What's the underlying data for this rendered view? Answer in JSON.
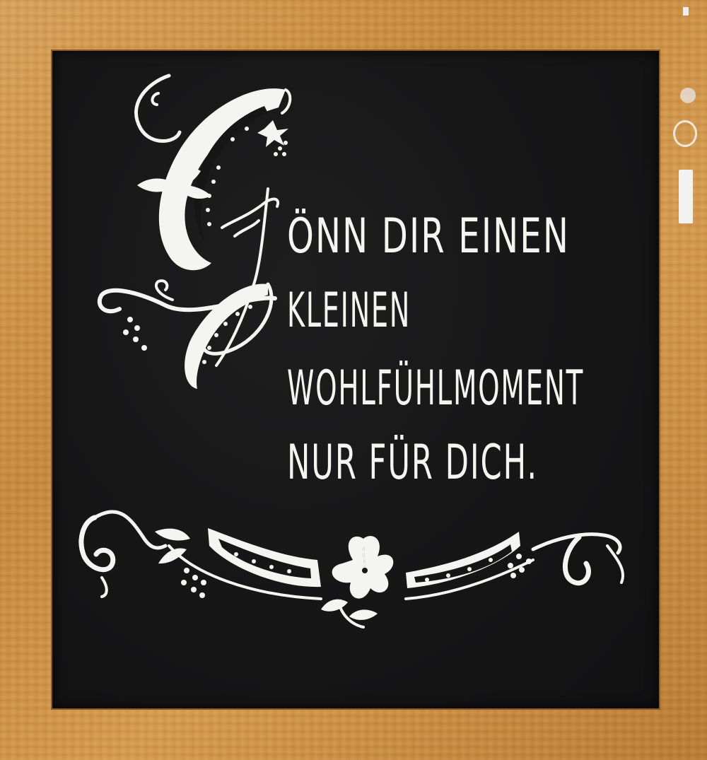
{
  "chalkboard": {
    "lines": [
      "ÖNN DIR EINEN",
      "KLEINEN",
      "WOHLFÜHLMOMENT",
      "NUR FÜR DICH."
    ],
    "initial_letter": "G"
  },
  "colors": {
    "chalk": "#f4f4f0",
    "board": "#161617",
    "frame_wood": "#c98f42"
  }
}
